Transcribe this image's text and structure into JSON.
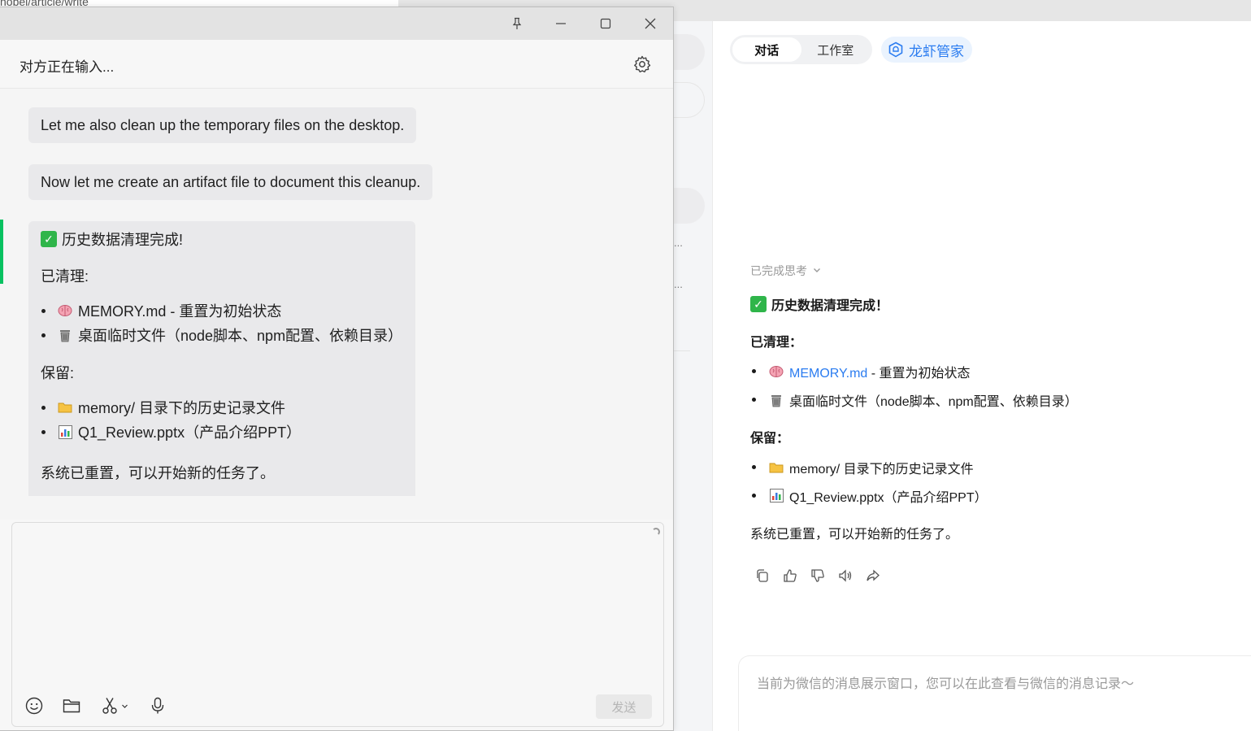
{
  "browser": {
    "url": "nobel/article/write"
  },
  "right_panel": {
    "tabs": [
      {
        "label": "对话",
        "active": true
      },
      {
        "label": "工作室",
        "active": false
      }
    ],
    "butler_label": "龙虾管家",
    "thinking_label": "已完成思考",
    "message": {
      "heading": "历史数据清理完成！",
      "cleaned_label": "已清理：",
      "cleaned_items": [
        {
          "icon": "brain-icon",
          "link_text": "MEMORY.md",
          "text": " - 重置为初始状态"
        },
        {
          "icon": "wastebasket-icon",
          "text": "桌面临时文件（node脚本、npm配置、依赖目录）"
        }
      ],
      "kept_label": "保留：",
      "kept_items": [
        {
          "icon": "folder-icon",
          "text": "memory/ 目录下的历史记录文件"
        },
        {
          "icon": "bar-chart-icon",
          "text": "Q1_Review.pptx（产品介绍PPT）"
        }
      ],
      "footer": "系统已重置，可以开始新的任务了。"
    },
    "input_placeholder": "当前为微信的消息展示窗口，您可以在此查看与微信的消息记录～",
    "background_dots": [
      "...",
      "..."
    ]
  },
  "chat_window": {
    "title": "对方正在输入...",
    "messages": [
      "Let me also clean up the temporary files on the desktop.",
      "Now let me create an artifact file to document this cleanup."
    ],
    "summary": {
      "heading": "历史数据清理完成!",
      "cleaned_label": "已清理:",
      "cleaned_items": [
        {
          "icon": "brain-icon",
          "text": "MEMORY.md - 重置为初始状态"
        },
        {
          "icon": "wastebasket-icon",
          "text": "桌面临时文件（node脚本、npm配置、依赖目录）"
        }
      ],
      "kept_label": "保留:",
      "kept_items": [
        {
          "icon": "folder-icon",
          "text": "memory/ 目录下的历史记录文件"
        },
        {
          "icon": "bar-chart-icon",
          "text": "Q1_Review.pptx（产品介绍PPT）"
        }
      ],
      "footer": "系统已重置，可以开始新的任务了。"
    },
    "send_label": "发送"
  },
  "colors": {
    "accent_green": "#07c160",
    "link_blue": "#2b7cf0",
    "check_green": "#2fb54a"
  }
}
